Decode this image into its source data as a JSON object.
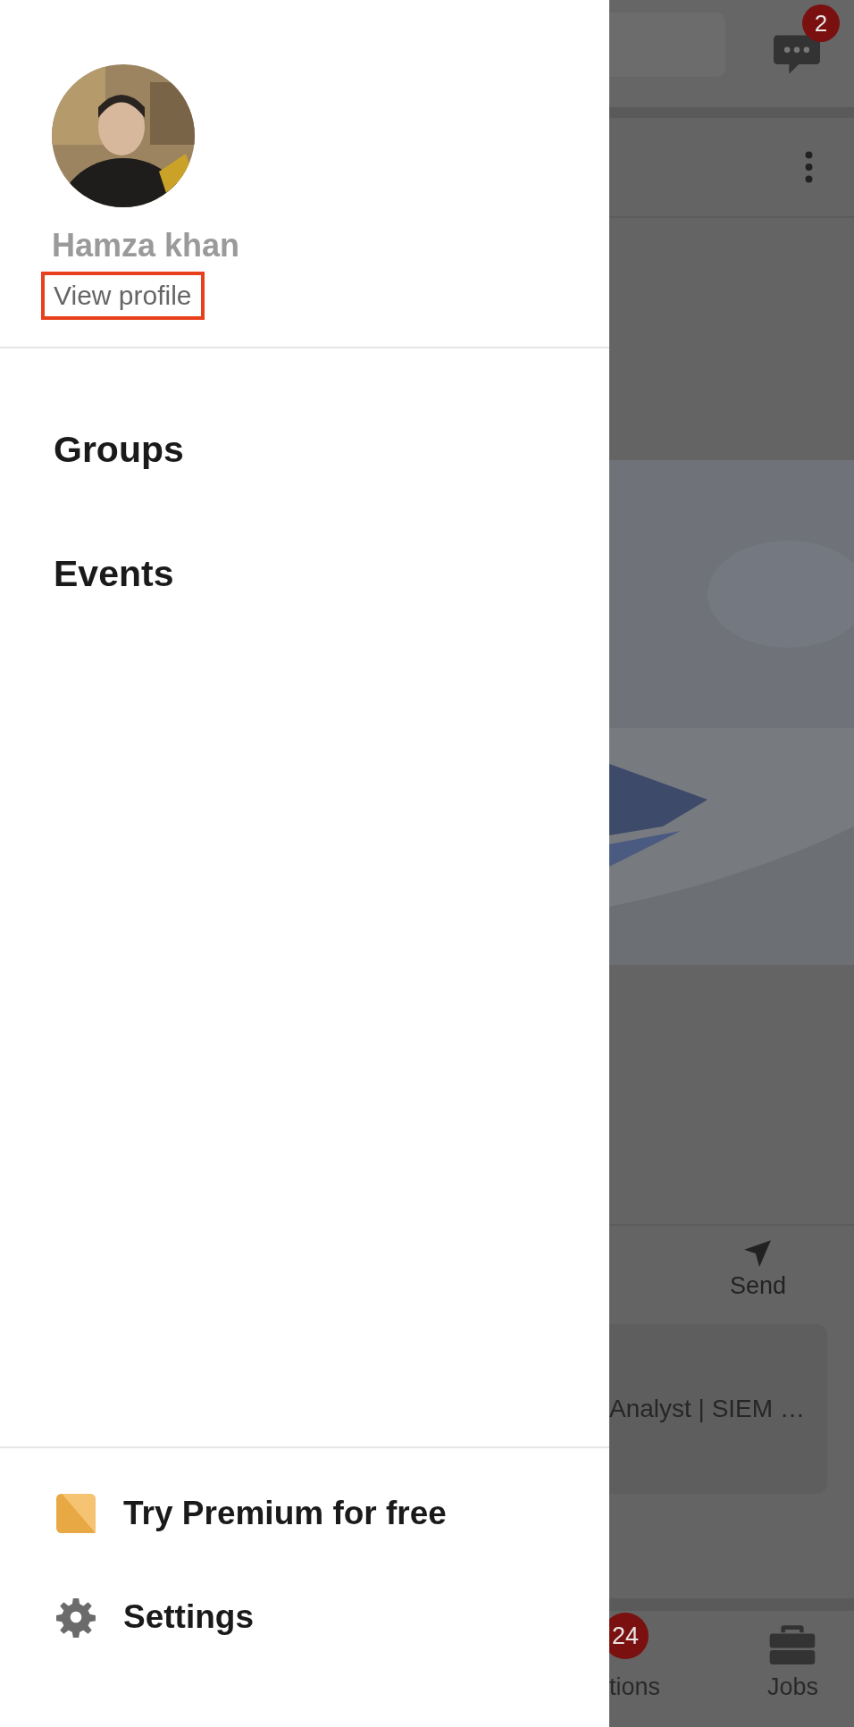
{
  "drawer": {
    "profile": {
      "name": "Hamza khan",
      "link": {
        "label": "View profile",
        "highlighted": true
      }
    },
    "menu": [
      {
        "label": "Groups"
      },
      {
        "label": "Events"
      }
    ],
    "footer": [
      {
        "kind": "premium",
        "label": "Try Premium for free"
      },
      {
        "kind": "settings",
        "label": "Settings"
      }
    ]
  },
  "background_app": {
    "messages_badge": "2",
    "actions": [
      {
        "kind": "send",
        "label": "Send"
      }
    ],
    "card_text": "Analyst | SIEM …",
    "bottom_nav": [
      {
        "kind": "notifications",
        "badge": "24",
        "label": "tions"
      },
      {
        "kind": "jobs",
        "label": "Jobs"
      }
    ]
  }
}
